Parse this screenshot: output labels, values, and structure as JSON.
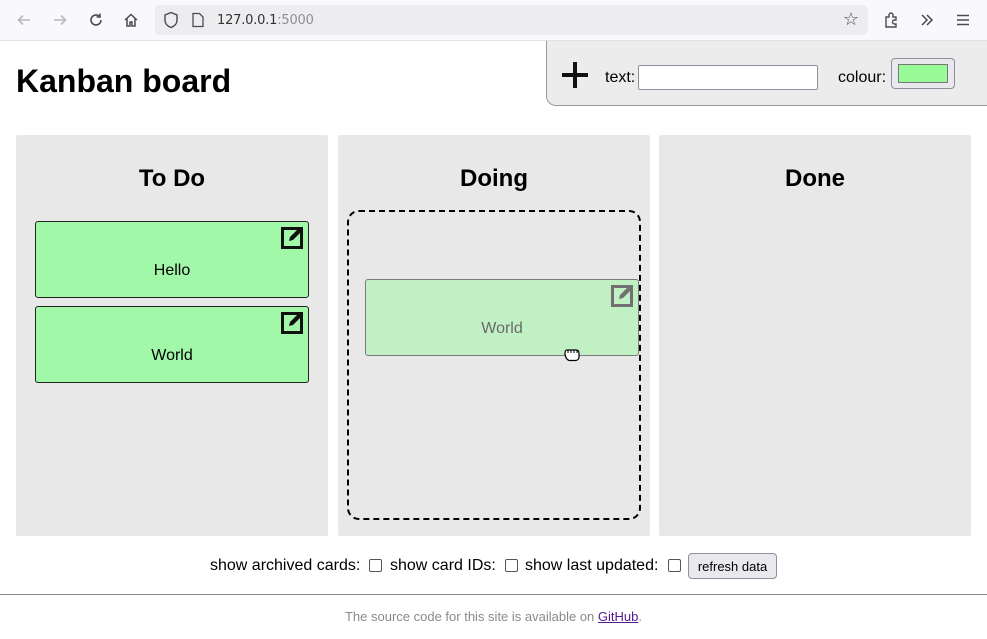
{
  "browser": {
    "url_host": "127.0.0.1",
    "url_port": ":5000"
  },
  "page": {
    "title": "Kanban board"
  },
  "add_card": {
    "text_label": "text:",
    "text_value": "",
    "colour_label": "colour:",
    "colour_value": "#98fb98"
  },
  "columns": [
    {
      "title": "To Do",
      "cards": [
        {
          "text": "Hello",
          "colour": "#a1f8a8"
        },
        {
          "text": "World",
          "colour": "#a1f8a8"
        }
      ]
    },
    {
      "title": "Doing",
      "cards": [
        {
          "text": "World",
          "colour": "#a1f8a8",
          "dragging": true
        }
      ]
    },
    {
      "title": "Done",
      "cards": []
    }
  ],
  "options": {
    "archived_label": "show archived cards:",
    "archived_checked": false,
    "ids_label": "show card IDs:",
    "ids_checked": false,
    "updated_label": "show last updated:",
    "updated_checked": false,
    "refresh_label": "refresh data"
  },
  "footer": {
    "text_before": "The source code for this site is available on ",
    "link_text": "GitHub",
    "text_after": "."
  }
}
